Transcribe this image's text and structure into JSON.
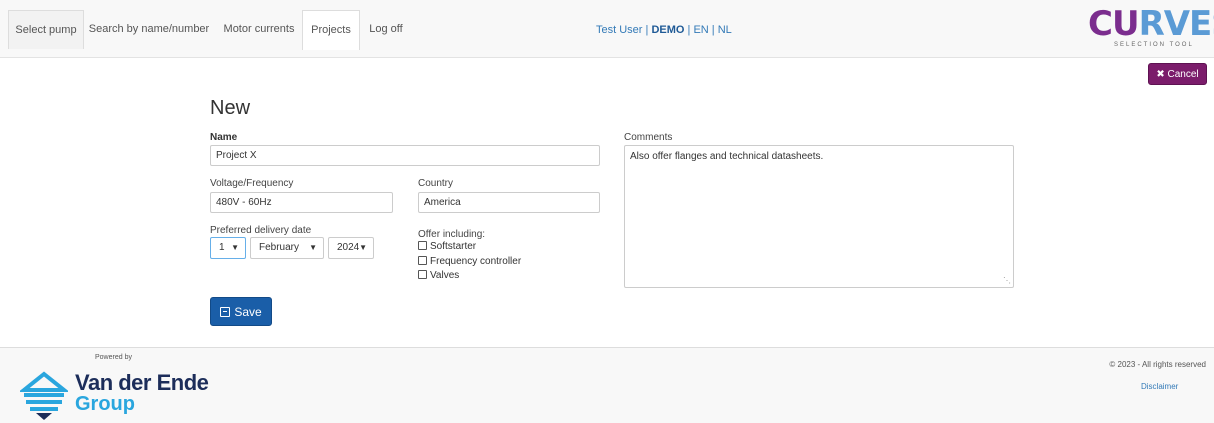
{
  "nav": {
    "tabs": [
      "Select pump",
      "Search by name/number",
      "Motor currents",
      "Projects",
      "Log off"
    ],
    "active_tab": "Projects",
    "user": "Test User",
    "mode": "DEMO",
    "lang_en": "EN",
    "lang_nl": "NL",
    "separator": "|"
  },
  "logo": {
    "word_a": "CU",
    "word_b": "RVES",
    "subtitle": "SELECTION TOOL"
  },
  "cancel_label": "✖ Cancel",
  "form": {
    "heading": "New",
    "name_label": "Name",
    "name_value": "Project X",
    "voltage_label": "Voltage/Frequency",
    "voltage_value": "480V - 60Hz",
    "country_label": "Country",
    "country_value": "America",
    "date_label": "Preferred delivery date",
    "date_day": "1",
    "date_month": "February",
    "date_year": "2024",
    "offer_label": "Offer including:",
    "offer_options": [
      "Softstarter",
      "Frequency controller",
      "Valves"
    ],
    "comments_label": "Comments",
    "comments_value": "Also offer flanges and technical datasheets.",
    "save_label": "Save"
  },
  "footer": {
    "powered_by": "Powered by",
    "brand_line1": "Van der Ende",
    "brand_line2": "Group",
    "rights": "© 2023 - All rights reserved",
    "disclaimer": "Disclaimer"
  },
  "colors": {
    "accent": "#1a5ea8",
    "cancel": "#7b1c6b",
    "link": "#337ab7"
  }
}
